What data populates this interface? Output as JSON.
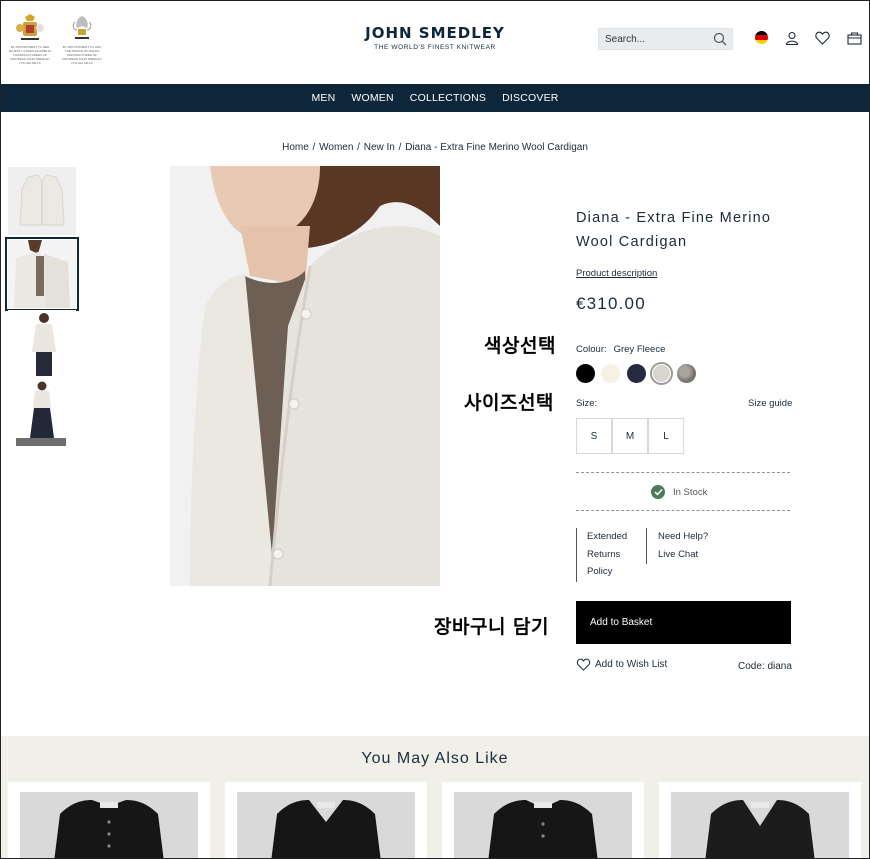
{
  "header": {
    "brand": "JOHN SMEDLEY",
    "tagline": "THE WORLD'S FINEST KNITWEAR",
    "search_placeholder": "Search...",
    "crest1_fine": "BY APPOINTMENT TO HER MAJESTY QUEEN ELIZABETH II MANUFACTURERS OF KNITWEAR JOHN SMEDLEY LTD LEA MILLS",
    "crest2_fine": "BY APPOINTMENT TO HRH THE PRINCE OF WALES MANUFACTURER OF KNITWEAR JOHN SMEDLEY LTD LEA MILLS"
  },
  "nav": {
    "items": [
      "MEN",
      "WOMEN",
      "COLLECTIONS",
      "DISCOVER"
    ]
  },
  "breadcrumb": [
    "Home",
    "Women",
    "New In",
    "Diana - Extra Fine Merino Wool Cardigan"
  ],
  "product": {
    "name": "Diana - Extra Fine Merino Wool Cardigan",
    "description_link": "Product description",
    "price": "€310.00",
    "colour_label": "Colour:",
    "colour_value": "Grey Fleece",
    "swatches": [
      "#000000",
      "#f6f1e3",
      "#252a40",
      "#d9d4cd",
      "#8a8580"
    ],
    "size_label": "Size:",
    "size_guide": "Size guide",
    "sizes": [
      "S",
      "M",
      "L"
    ],
    "stock": "In Stock",
    "policy": [
      "Extended",
      "Returns",
      "Policy"
    ],
    "help": [
      "Need Help?",
      "Live Chat"
    ],
    "add_to_basket": "Add to Basket",
    "wishlist": "Add to Wish List",
    "code": "Code: diana"
  },
  "annotations": {
    "colour": "색상선택",
    "size": "사이즈선택",
    "basket": "장바구니 담기"
  },
  "recommendations": {
    "title": "You May Also Like"
  },
  "colors": {
    "navy": "#0e2639",
    "stock_green": "#4e7a5a"
  }
}
